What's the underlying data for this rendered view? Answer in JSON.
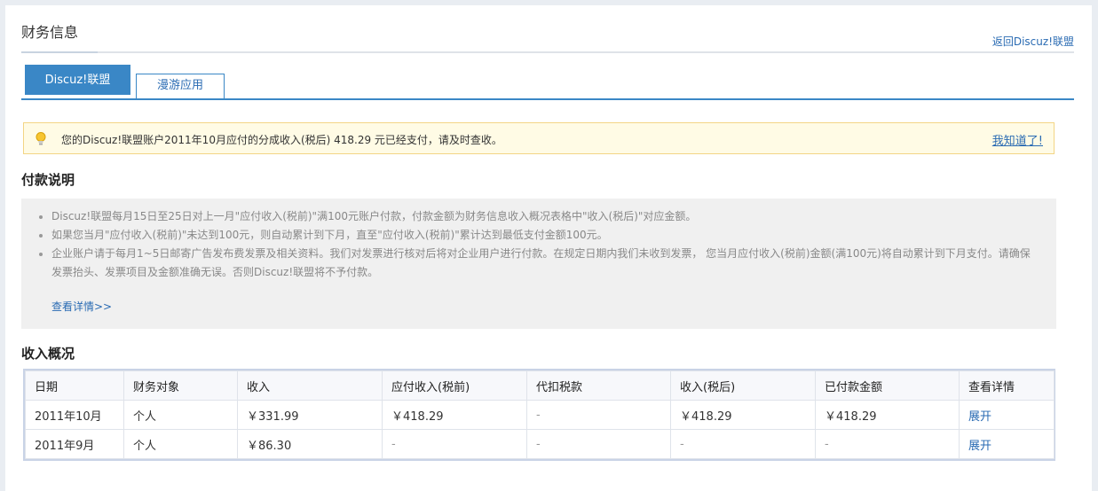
{
  "header": {
    "title": "财务信息",
    "back_link": "返回Discuz!联盟"
  },
  "tabs": [
    {
      "label": "Discuz!联盟",
      "active": true
    },
    {
      "label": "漫游应用",
      "active": false
    }
  ],
  "notice": {
    "icon": "lightbulb-icon",
    "text": "您的Discuz!联盟账户2011年10月应付的分成收入(税后) 418.29 元已经支付，请及时查收。",
    "dismiss": "我知道了!"
  },
  "payment": {
    "heading": "付款说明",
    "items": [
      "Discuz!联盟每月15日至25日对上一月\"应付收入(税前)\"满100元账户付款，付款金额为财务信息收入概况表格中\"收入(税后)\"对应金额。",
      "如果您当月\"应付收入(税前)\"未达到100元，则自动累计到下月，直至\"应付收入(税前)\"累计达到最低支付金额100元。",
      "企业账户请于每月1~5日邮寄广告发布费发票及相关资料。我们对发票进行核对后将对企业用户进行付款。在规定日期内我们未收到发票， 您当月应付收入(税前)金额(满100元)将自动累计到下月支付。请确保发票抬头、发票项目及金额准确无误。否则Discuz!联盟将不予付款。"
    ],
    "detail_link": "查看详情>>"
  },
  "income": {
    "heading": "收入概况",
    "columns": [
      "日期",
      "财务对象",
      "收入",
      "应付收入(税前)",
      "代扣税款",
      "收入(税后)",
      "已付款金额",
      "查看详情"
    ],
    "rows": [
      [
        "2011年10月",
        "个人",
        "￥331.99",
        "￥418.29",
        "-",
        "￥418.29",
        "￥418.29",
        "展开"
      ],
      [
        "2011年9月",
        "个人",
        "￥86.30",
        "-",
        "-",
        "-",
        "-",
        "展开"
      ]
    ]
  },
  "colors": {
    "accent": "#3a87c6",
    "link": "#2a6bb3",
    "notice_bg": "#fffbe5",
    "notice_border": "#f3d585"
  }
}
